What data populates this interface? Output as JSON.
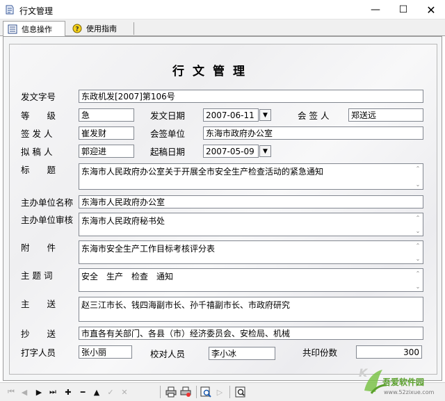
{
  "window": {
    "title": "行文管理",
    "min_glyph": "—",
    "max_glyph": "☐",
    "close_glyph": "✕"
  },
  "tabs": [
    {
      "label": "信息操作",
      "icon": "list-icon"
    },
    {
      "label": "使用指南",
      "icon": "help-icon"
    }
  ],
  "form": {
    "heading": "行文管理",
    "labels": {
      "doc_no": "发文字号",
      "grade": "等　　级",
      "issue_date": "发文日期",
      "cosigner": "会 签 人",
      "signer": "签 发 人",
      "cosign_unit": "会签单位",
      "drafter": "拟 稿 人",
      "draft_date": "起稿日期",
      "title": "标　　题",
      "host_unit": "主办单位名称",
      "host_review": "主办单位审核",
      "attachment": "附　　件",
      "subject_words": "主 题 词",
      "main_to": "主　　送",
      "copy_to": "抄　　送",
      "typist": "打字人员",
      "proofreader": "校对人员",
      "print_copies": "共印份数"
    },
    "values": {
      "doc_no": "东政机发[2007]第106号",
      "grade": "急",
      "issue_date": "2007-06-11",
      "cosigner": "郑送远",
      "signer": "崔发财",
      "cosign_unit": "东海市政府办公室",
      "drafter": "郭迎进",
      "draft_date": "2007-05-09",
      "title": "东海市人民政府办公室关于开展全市安全生产检查活动的紧急通知",
      "host_unit": "东海市人民政府办公室",
      "host_review": "东海市人民政府秘书处",
      "attachment": "东海市安全生产工作目标考核评分表",
      "subject_words": "安全　生产　检查　通知",
      "main_to": "赵三江市长、钱四海副市长、孙千禧副市长、市政府研究",
      "copy_to": "市直各有关部门、各县（市）经济委员会、安检局、机械",
      "typist": "张小丽",
      "proofreader": "李小冰",
      "print_copies": "300"
    }
  },
  "toolbar": {
    "buttons": [
      "first-icon",
      "prev-icon",
      "next-icon",
      "last-icon",
      "insert-icon",
      "delete-icon",
      "edit-icon",
      "post-icon",
      "cancel-icon",
      "print-icon",
      "print-preview-icon",
      "find-icon",
      "play-icon",
      "search-icon"
    ]
  },
  "watermark": {
    "brand": "吾爱软件园",
    "url": "www.52zixue.com"
  }
}
